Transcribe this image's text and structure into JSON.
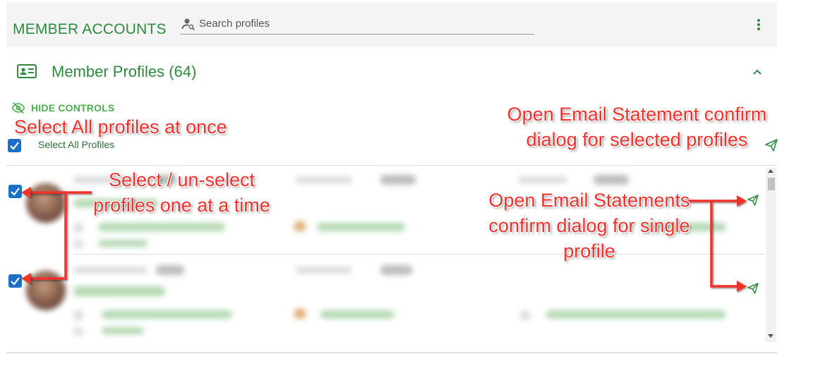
{
  "header": {
    "title": "MEMBER ACCOUNTS",
    "search_placeholder": "Search profiles",
    "menu_icon": "kebab-menu-icon"
  },
  "section": {
    "title": "Member Profiles (64)",
    "icon": "id-card-icon",
    "collapse_icon": "chevron-up-icon"
  },
  "controls": {
    "hide_controls_label": "HIDE CONTROLS",
    "select_all_label": "Select All Profiles",
    "select_all_checked": true
  },
  "profiles": [
    {
      "checked": true
    },
    {
      "checked": true
    }
  ],
  "annotations": {
    "select_all": "Select All profiles at once",
    "select_single": "Select / un-select profiles one at a time",
    "email_selected": "Open Email Statement confirm dialog for selected profiles",
    "email_single": "Open Email Statements confirm dialog for single profile"
  },
  "colors": {
    "brand_green": "#2e8b3e",
    "checkbox_blue": "#1a6fc9",
    "annotation_red": "#f0302a"
  }
}
